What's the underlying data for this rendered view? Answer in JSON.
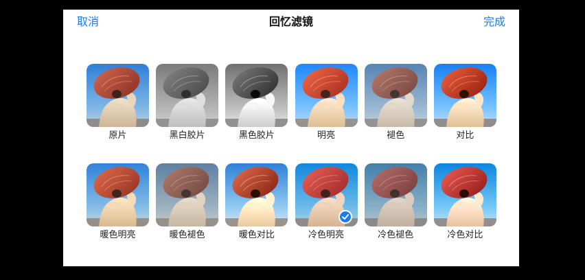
{
  "nav": {
    "cancel_label": "取消",
    "title": "回忆滤镜",
    "done_label": "完成"
  },
  "colors": {
    "accent": "#1a7cf0"
  },
  "filters": [
    {
      "label": "原片",
      "style": "orig",
      "selected": false
    },
    {
      "label": "黑白胶片",
      "style": "bw",
      "selected": false
    },
    {
      "label": "黑色胶片",
      "style": "noir",
      "selected": false
    },
    {
      "label": "明亮",
      "style": "vivid",
      "selected": false
    },
    {
      "label": "褪色",
      "style": "fade",
      "selected": false
    },
    {
      "label": "对比",
      "style": "contrast",
      "selected": false
    },
    {
      "label": "暖色明亮",
      "style": "warmvivid",
      "selected": false
    },
    {
      "label": "暖色褪色",
      "style": "warmfade",
      "selected": false
    },
    {
      "label": "暖色对比",
      "style": "warmcontrast",
      "selected": false
    },
    {
      "label": "冷色明亮",
      "style": "coolvivid",
      "selected": true
    },
    {
      "label": "冷色褪色",
      "style": "coolfade",
      "selected": false
    },
    {
      "label": "冷色对比",
      "style": "coolcontrast",
      "selected": false
    }
  ]
}
